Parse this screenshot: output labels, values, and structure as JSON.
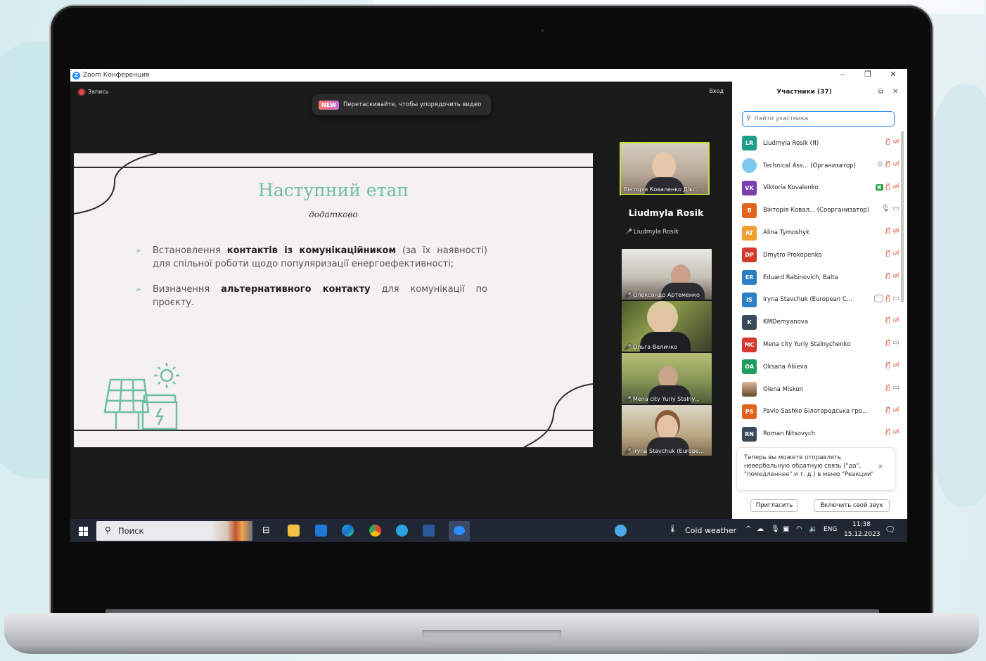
{
  "window": {
    "title": "Zoom Конференция"
  },
  "meeting": {
    "recording_label": "Запись",
    "signin_label": "Вход",
    "tip_badge": "NEW",
    "tip_text": "Перетаскивайте, чтобы упорядочить видео"
  },
  "slide": {
    "title": "Наступний етап",
    "subtitle": "додатково",
    "bullets": [
      {
        "pre": "Встановлення ",
        "bold": "контактів із комунікаційником",
        "post": " (за їх наявності) для спільної роботи щодо популяризації енергоефективності;"
      },
      {
        "pre": "Визначення ",
        "bold": "альтернативного контакту",
        "post": " для комунікації по проєкту."
      }
    ]
  },
  "videos": {
    "top": "Вікторія Коваленко Дікс...",
    "host_name": "Liudmyla Rosik",
    "host_sub": "Liudmyla Rosik",
    "tiles": [
      "Олександр Артеменко",
      "Ольга Величко",
      "Mena city Yuriy Stalny...",
      "Iryna Stavchuk (Europe..."
    ]
  },
  "participants": {
    "title": "Участники (37)",
    "search_placeholder": "Найти участника",
    "list": [
      {
        "initials": "LR",
        "name": "Liudmyla Rosik (Я)",
        "color": "#1f9d8c"
      },
      {
        "initials": "",
        "name": "Technical Ass... (Организатор)",
        "color": "#7fc8f0"
      },
      {
        "initials": "VK",
        "name": "Viktoria Kovalenko",
        "color": "#7b3fb0"
      },
      {
        "initials": "В",
        "name": "Вікторія Ковал... (Соорганизатор)",
        "color": "#e0641c"
      },
      {
        "initials": "AT",
        "name": "Alina Tymoshyk",
        "color": "#f0a030"
      },
      {
        "initials": "DP",
        "name": "Dmytro Prokopenko",
        "color": "#d33a2c"
      },
      {
        "initials": "ER",
        "name": "Eduard Rabinovich, Balta",
        "color": "#2b7fc4"
      },
      {
        "initials": "IS",
        "name": "Iryna Stavchuk (European C...",
        "color": "#2b7fc4"
      },
      {
        "initials": "K",
        "name": "KMDemyanova",
        "color": "#3a4a5a"
      },
      {
        "initials": "MC",
        "name": "Mena city Yuriy Stalnychenko",
        "color": "#d33a2c"
      },
      {
        "initials": "OA",
        "name": "Oksana Aliieva",
        "color": "#1f9d5c"
      },
      {
        "initials": "",
        "name": "Olena Miskun",
        "color": "#8a6a4a"
      },
      {
        "initials": "PS",
        "name": "Pavlo Sashko Білогородська гро...",
        "color": "#e0641c"
      },
      {
        "initials": "RN",
        "name": "Roman Nitsovych",
        "color": "#3a4a5a"
      }
    ],
    "notice": "Теперь вы можете отправлять невербальную обратную связь (\"да\", \"помедленнее\" и т. д.) в меню \"Реакции\"",
    "invite_button": "Пригласить",
    "unmute_button": "Включить свой звук"
  },
  "taskbar": {
    "search_label": "Поиск",
    "weather": "Cold weather",
    "lang": "ENG",
    "time": "11:38",
    "date": "15.12.2023"
  },
  "colors": {
    "zoom_blue": "#2d8cff",
    "slide_accent": "#6fc0a0",
    "muted_red": "#e0503a"
  }
}
